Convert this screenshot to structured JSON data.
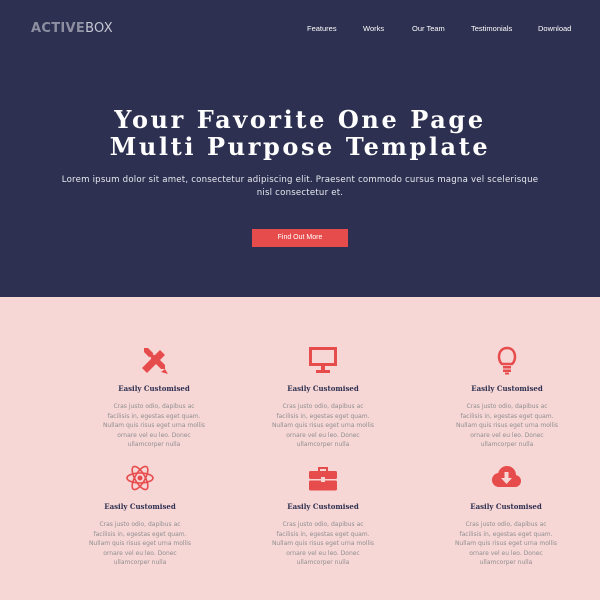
{
  "brand": {
    "logo_part1": "ACTIVE",
    "logo_part2": "BOX"
  },
  "nav": {
    "items": [
      "Features",
      "Works",
      "Our Team",
      "Testimonials",
      "Download"
    ]
  },
  "hero": {
    "headline_line1": "Your Favorite One Page",
    "headline_line2": "Multi Purpose Template",
    "subtitle": "Lorem ipsum dolor sit amet, consectetur adipiscing elit. Praesent commodo cursus magna vel scelerisque nisl consectetur et.",
    "cta_label": "Find Out More"
  },
  "features": {
    "items": [
      {
        "icon": "pencil-ruler-icon",
        "title": "Easily Customised",
        "description": "Cras justo odio, dapibus ac facilisis in, egestas eget quam. Nullam quis risus eget urna mollis ornare vel eu leo. Donec ullamcorper nulla"
      },
      {
        "icon": "monitor-icon",
        "title": "Easily Customised",
        "description": "Cras justo odio, dapibus ac facilisis in, egestas eget quam. Nullam quis risus eget urna mollis ornare vel eu leo. Donec ullamcorper nulla"
      },
      {
        "icon": "lightbulb-icon",
        "title": "Easily Customised",
        "description": "Cras justo odio, dapibus ac facilisis in, egestas eget quam. Nullam quis risus eget urna mollis ornare vel eu leo. Donec ullamcorper nulla"
      },
      {
        "icon": "atom-icon",
        "title": "Easily Customised",
        "description": "Cras justo odio, dapibus ac facilisis in, egestas eget quam. Nullam quis risus eget urna mollis ornare vel eu leo. Donec ullamcorper nulla"
      },
      {
        "icon": "briefcase-icon",
        "title": "Easily Customised",
        "description": "Cras justo odio, dapibus ac facilisis in, egestas eget quam. Nullam quis risus eget urna mollis ornare vel eu leo. Donec ullamcorper nulla"
      },
      {
        "icon": "cloud-download-icon",
        "title": "Easily Customised",
        "description": "Cras justo odio, dapibus ac facilisis in, egestas eget quam. Nullam quis risus eget urna mollis ornare vel eu leo. Donec ullamcorper nulla"
      }
    ]
  },
  "colors": {
    "hero_bg": "#2d3050",
    "accent": "#e74c4c",
    "features_bg": "#f7d6d6",
    "body_text": "#8f8f8f"
  }
}
